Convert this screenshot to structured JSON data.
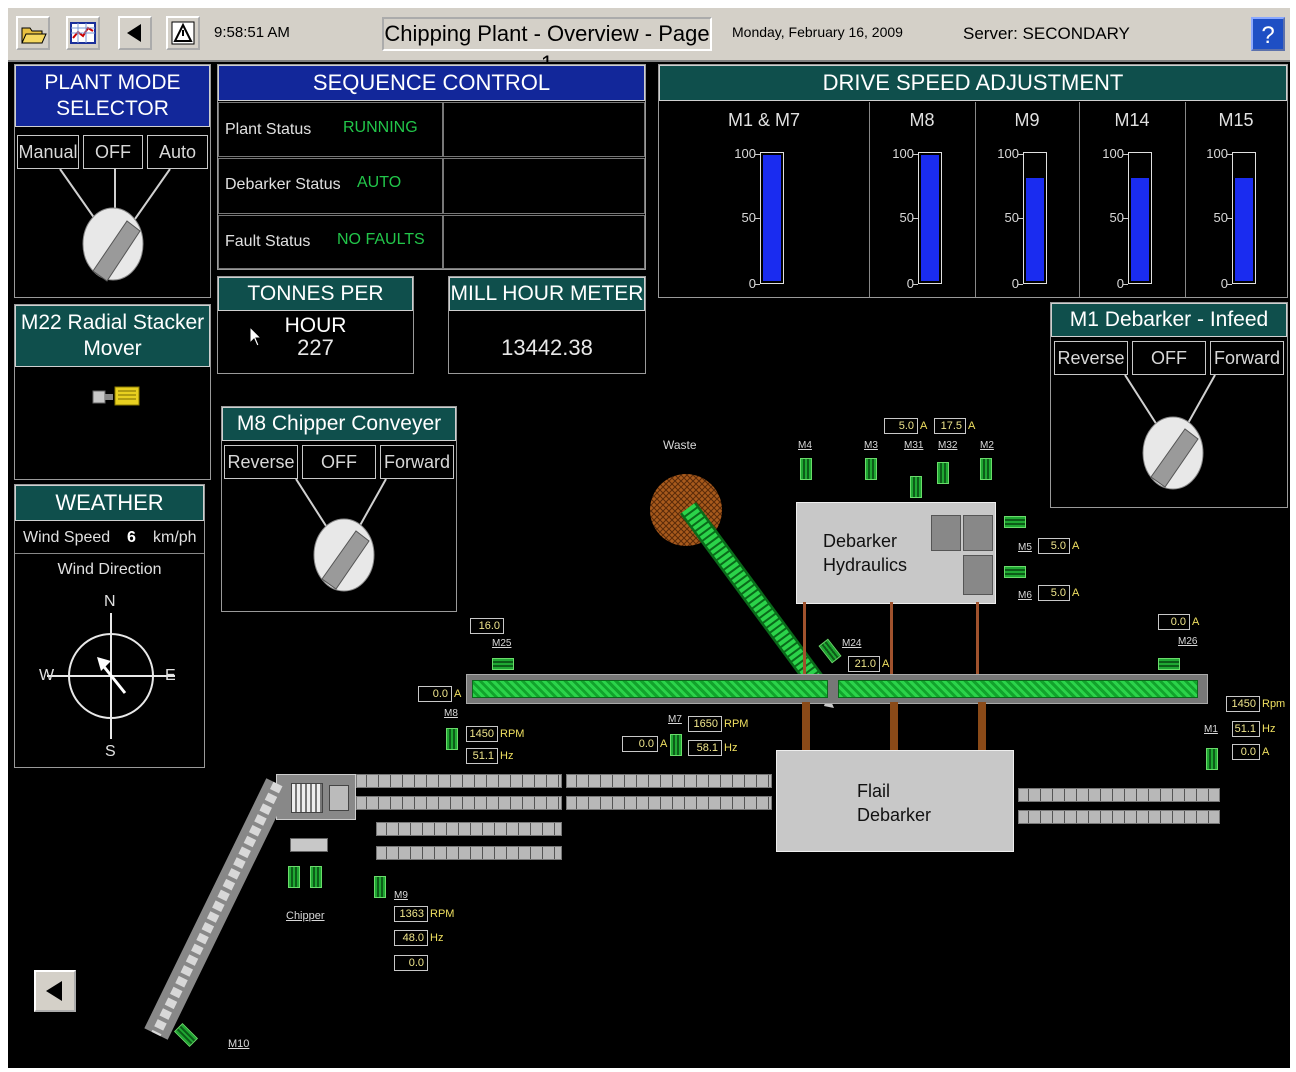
{
  "toolbar": {
    "time": "9:58:51 AM",
    "title": "Chipping Plant - Overview - Page 1",
    "date": "Monday, February 16, 2009",
    "server": "Server: SECONDARY",
    "help": "?"
  },
  "plant_mode": {
    "title_line1": "PLANT MODE",
    "title_line2": "SELECTOR",
    "options": [
      "Manual",
      "OFF",
      "Auto"
    ]
  },
  "sequence": {
    "title": "SEQUENCE CONTROL",
    "rows": [
      {
        "label": "Plant Status",
        "value": "RUNNING"
      },
      {
        "label": "Debarker Status",
        "value": "AUTO"
      },
      {
        "label": "Fault Status",
        "value": "NO FAULTS"
      }
    ]
  },
  "tph": {
    "title": "TONNES PER HOUR",
    "value": "227"
  },
  "mill_hour": {
    "title": "MILL HOUR METER",
    "value": "13442.38"
  },
  "drive_speed": {
    "title": "DRIVE SPEED ADJUSTMENT",
    "ticks": [
      "100",
      "50",
      "0"
    ],
    "drives": [
      {
        "name": "M1 & M7",
        "level": 1.0
      },
      {
        "name": "M8",
        "level": 1.0
      },
      {
        "name": "M9",
        "level": 0.82
      },
      {
        "name": "M14",
        "level": 0.82
      },
      {
        "name": "M15",
        "level": 0.82
      }
    ]
  },
  "stacker": {
    "title_line1": "M22 Radial Stacker",
    "title_line2": "Mover"
  },
  "weather": {
    "title": "WEATHER",
    "wind_speed_label": "Wind Speed",
    "wind_speed": "6",
    "wind_unit": "km/ph",
    "wind_dir_label": "Wind Direction",
    "compass": {
      "n": "N",
      "s": "S",
      "e": "E",
      "w": "W"
    }
  },
  "m8_chipper": {
    "title": "M8 Chipper Conveyer",
    "options": [
      "Reverse",
      "OFF",
      "Forward"
    ]
  },
  "m1_debarker": {
    "title": "M1 Debarker - Infeed",
    "options": [
      "Reverse",
      "OFF",
      "Forward"
    ]
  },
  "process": {
    "waste": "Waste",
    "debarker_hydraulics_1": "Debarker",
    "debarker_hydraulics_2": "Hydraulics",
    "flail_1": "Flail",
    "flail_2": "Debarker",
    "chipper": "Chipper",
    "motors": {
      "m4": "M4",
      "m3": "M3",
      "m31": "M31",
      "m32": "M32",
      "m2": "M2",
      "m5": "M5",
      "m6": "M6",
      "m24": "M24",
      "m25": "M25",
      "m26": "M26",
      "m8": "M8",
      "m7": "M7",
      "m1": "M1",
      "m9": "M9",
      "m10": "M10"
    },
    "values": {
      "m31_amps": "5.0",
      "m32_amps": "17.5",
      "m5_amps": "5.0",
      "m6_amps": "5.0",
      "m24_amps": "21.0",
      "m25_val": "16.0",
      "m26_amps": "0.0",
      "m8_amps": "0.0",
      "m8_rpm": "1450",
      "m8_hz": "51.1",
      "m7_amps": "0.0",
      "m7_rpm": "1650",
      "m7_hz": "58.1",
      "m1_rpm": "1450",
      "m1_hz": "51.1",
      "m1_amps": "0.0",
      "m9_rpm": "1363",
      "m9_hz": "48.0",
      "m9_amps": "0.0"
    },
    "units": {
      "a": "A",
      "rpm": "RPM",
      "rpm2": "Rpm",
      "hz": "Hz"
    }
  },
  "colors": {
    "panel_blue": "#12279a",
    "panel_teal": "#0f4f4c",
    "status_green": "#22c64a",
    "bar_blue": "#1a2cf0",
    "belt_green": "#2bd34a"
  }
}
